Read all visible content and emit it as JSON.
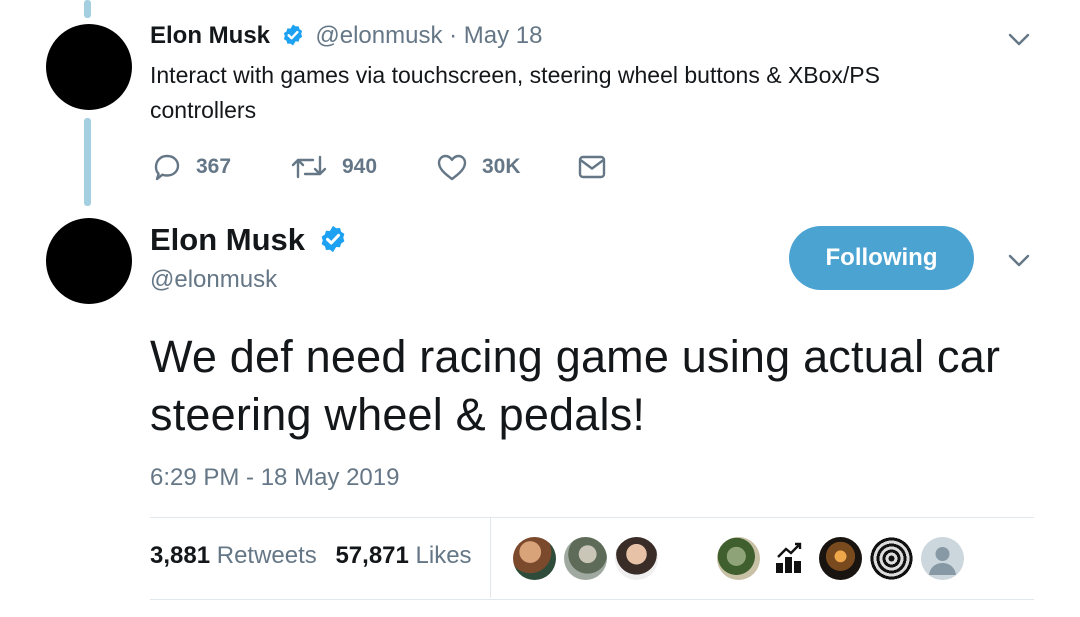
{
  "parent_tweet": {
    "name": "Elon Musk",
    "handle": "@elonmusk",
    "separator": "·",
    "date": "May 18",
    "text": "Interact with games via touchscreen, steering wheel buttons & XBox/PS controllers",
    "actions": {
      "replies": "367",
      "retweets": "940",
      "likes": "30K"
    }
  },
  "main_tweet": {
    "name": "Elon Musk",
    "handle": "@elonmusk",
    "follow_label": "Following",
    "text": "We def need racing game using actual car steering wheel & pedals!",
    "timestamp": "6:29 PM - 18 May 2019",
    "stats": {
      "retweets_count": "3,881",
      "retweets_label": "Retweets",
      "likes_count": "57,871",
      "likes_label": "Likes"
    }
  },
  "colors": {
    "accent": "#4ba3d1",
    "verified": "#1da1f2",
    "thread_line": "#a4cfe1",
    "secondary_text": "#657786"
  },
  "icons": [
    "verified-badge-icon",
    "chevron-down-icon",
    "reply-icon",
    "retweet-icon",
    "like-icon",
    "direct-message-icon"
  ]
}
